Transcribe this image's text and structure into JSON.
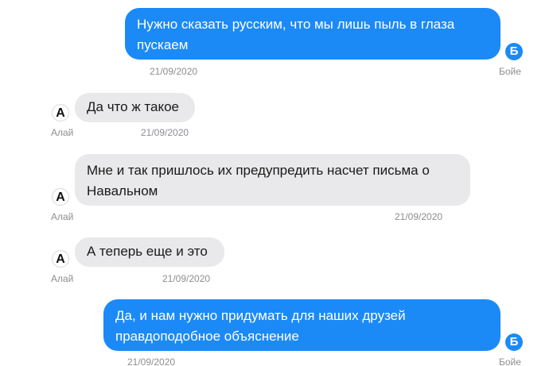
{
  "messages": [
    {
      "direction": "outgoing",
      "text": "Нужно сказать русским, что мы лишь пыль в глаза пускаем",
      "sender": "Бойе",
      "avatar_letter": "Б",
      "date": "21/09/2020"
    },
    {
      "direction": "incoming",
      "text": "Да что ж такое",
      "sender": "Алай",
      "avatar_letter": "А",
      "date": "21/09/2020"
    },
    {
      "direction": "incoming",
      "text": "Мне и так пришлось их предупредить насчет письма о Навальном",
      "sender": "Алай",
      "avatar_letter": "А",
      "date": "21/09/2020"
    },
    {
      "direction": "incoming",
      "text": "А теперь еще и это",
      "sender": "Алай",
      "avatar_letter": "А",
      "date": "21/09/2020"
    },
    {
      "direction": "outgoing",
      "text": "Да, и нам нужно придумать для наших друзей правдоподобное объяснение",
      "sender": "Бойе",
      "avatar_letter": "Б",
      "date": "21/09/2020"
    }
  ],
  "colors": {
    "outgoing_bubble": "#1b8af7",
    "incoming_bubble": "#e9e9eb",
    "meta_text": "#8e8e93"
  }
}
